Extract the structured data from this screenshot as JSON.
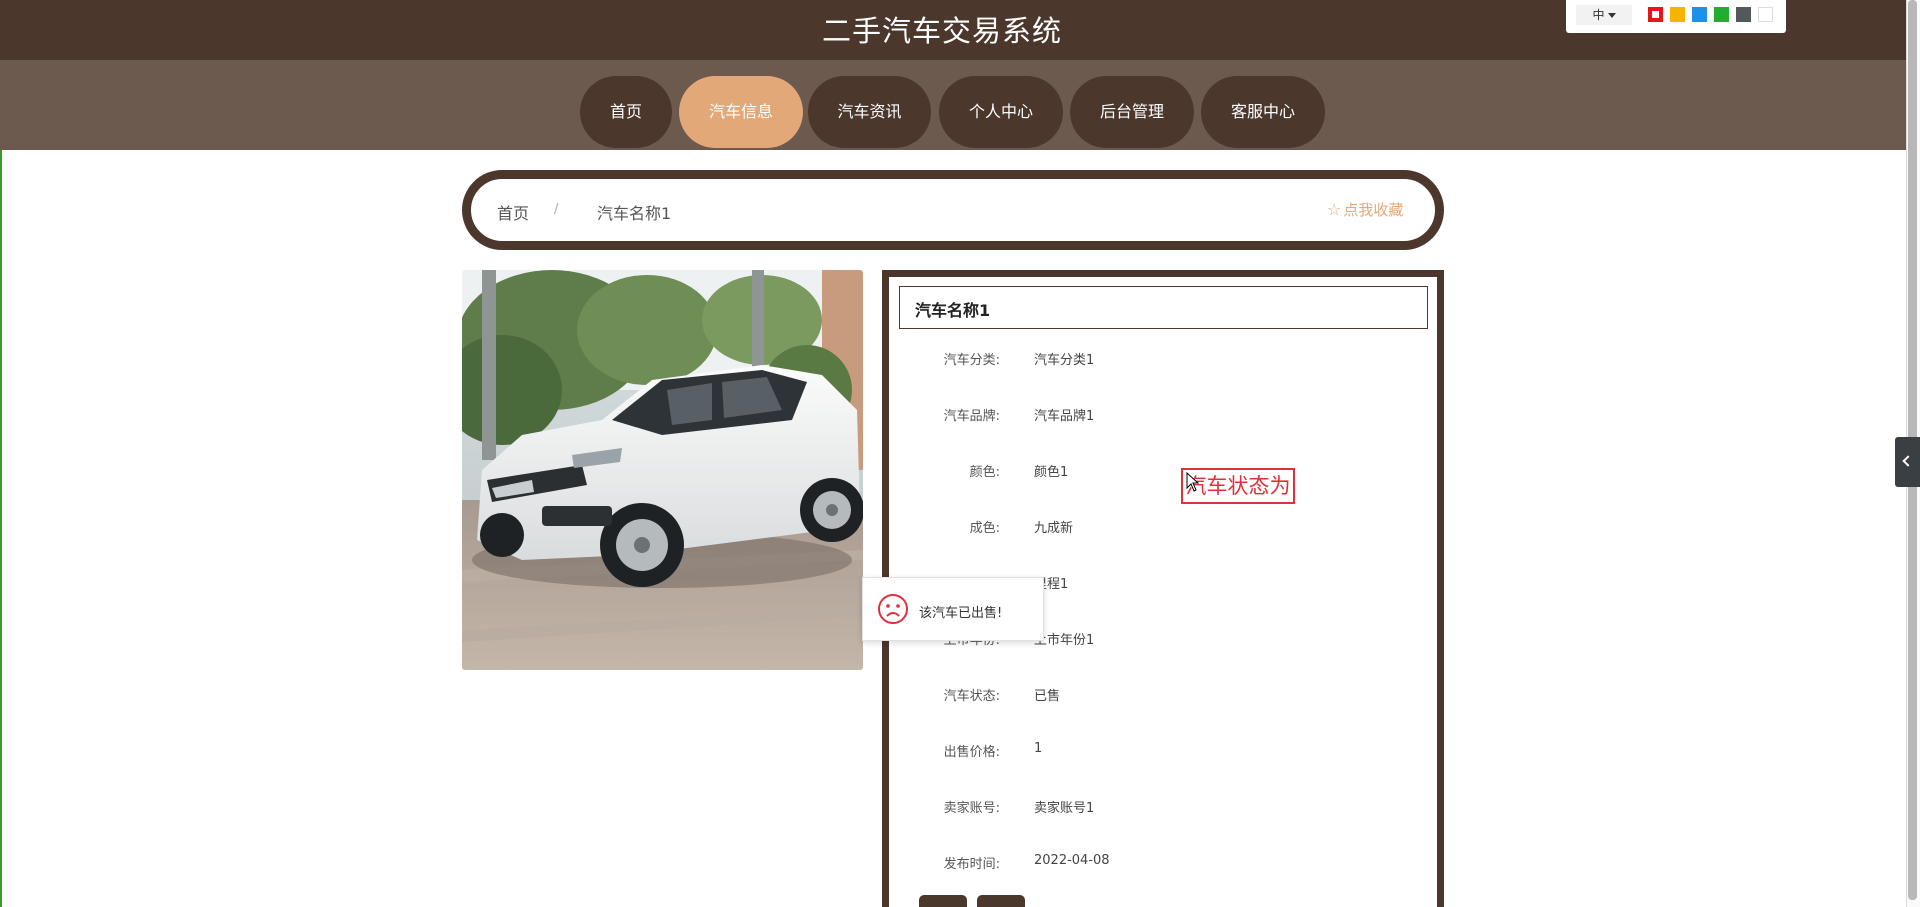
{
  "header": {
    "site_title": "二手汽车交易系统"
  },
  "lang_switch": {
    "selected": "中",
    "theme_colors": [
      "#e8141a",
      "#f4b400",
      "#1e90e8",
      "#1fae32",
      "#55585b",
      "#ffffff"
    ]
  },
  "nav": {
    "items": [
      {
        "label": "首页"
      },
      {
        "label": "汽车信息",
        "active": true
      },
      {
        "label": "汽车资讯"
      },
      {
        "label": "个人中心"
      },
      {
        "label": "后台管理"
      },
      {
        "label": "客服中心"
      }
    ]
  },
  "breadcrumb": {
    "home": "首页",
    "separator": "/",
    "current": "汽车名称1"
  },
  "favorite": {
    "icon": "star-outline-icon",
    "label": "点我收藏"
  },
  "detail": {
    "name": "汽车名称1",
    "fields": [
      {
        "label": "汽车分类:",
        "value": "汽车分类1"
      },
      {
        "label": "汽车品牌:",
        "value": "汽车品牌1"
      },
      {
        "label": "颜色:",
        "value": "颜色1"
      },
      {
        "label": "成色:",
        "value": "九成新"
      },
      {
        "label": "里程:",
        "value": "里程1"
      },
      {
        "label": "上市年份:",
        "value": "上市年份1"
      },
      {
        "label": "汽车状态:",
        "value": "已售"
      },
      {
        "label": "出售价格:",
        "value": "1"
      },
      {
        "label": "卖家账号:",
        "value": "卖家账号1"
      },
      {
        "label": "发布时间:",
        "value": "2022-04-08"
      }
    ]
  },
  "tooltip": {
    "text": "汽车状态为"
  },
  "toast": {
    "icon": "sad-face-icon",
    "message": "该汽车已出售!"
  },
  "colors": {
    "primary": "#4b372c",
    "accent": "#e3a878",
    "alert": "#e0303a"
  }
}
